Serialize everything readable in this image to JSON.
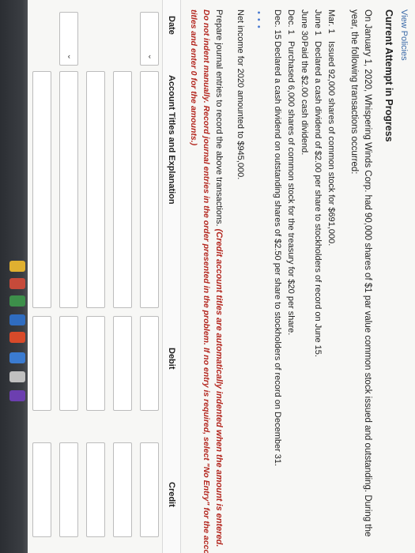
{
  "header": {
    "view_policies": "View Policies",
    "attempt_title": "Current Attempt in Progress"
  },
  "problem": {
    "intro_line1": "On January 1, 2020, Whispering Winds Corp. had 90,000 shares of $1 par value common stock issued and outstanding. During the",
    "intro_line2": "year, the following transactions occurred:",
    "transactions": [
      {
        "date": "Mar. 1",
        "text": "Issued 92,000 shares of common stock for $691,000."
      },
      {
        "date": "June 1",
        "text": "Declared a cash dividend of $2.00 per share to stockholders of record on June 15."
      },
      {
        "date": "June 30",
        "text": "Paid the $2.00 cash dividend."
      },
      {
        "date": "Dec. 1",
        "text": "Purchased 6,000 shares of common stock for the treasury for $20 per share."
      },
      {
        "date": "Dec. 15",
        "text": "Declared a cash dividend on outstanding shares of $2.50 per share to stockholders of record on December 31."
      }
    ],
    "net_income": "Net income for 2020 amounted to $945,000.",
    "instruction_plain": "Prepare journal entries to record the above transactions.",
    "instruction_red1": "(Credit account titles are automatically indented when the amount is entered.",
    "instruction_red2": "Do not indent manually. Record journal entries in the order presented in the problem. If no entry is required, select \"No Entry\" for the account",
    "instruction_red3": "titles and enter 0 for the amounts.)"
  },
  "table": {
    "col_date": "Date",
    "col_account": "Account Titles and Explanation",
    "col_debit": "Debit",
    "col_credit": "Credit"
  },
  "colors": {
    "accent_link": "#3b6aa8",
    "instruction_red": "#b3261e"
  }
}
